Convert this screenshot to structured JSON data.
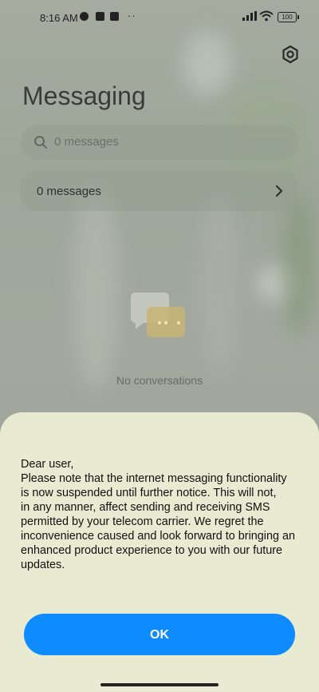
{
  "status_bar": {
    "time": "8:16 AM",
    "more_indicator": "··",
    "battery": "100"
  },
  "header": {
    "title": "Messaging"
  },
  "search": {
    "placeholder": "0 messages"
  },
  "messages_row": {
    "label": "0 messages"
  },
  "empty_state": {
    "text": "No conversations"
  },
  "dialog": {
    "lines": [
      "Dear user,",
      "Please note that the internet messaging functionality",
      "is now suspended until further notice. This will not,",
      "in any manner, affect sending and receiving SMS",
      "permitted by your telecom carrier. We regret the",
      "inconvenience caused and look forward to bringing an",
      "enhanced product experience to you with our future",
      "updates."
    ],
    "ok_label": "OK"
  },
  "colors": {
    "accent": "#0e8bff",
    "sheet_background": "#e8ebd1"
  },
  "icons": {
    "settings": "settings-icon",
    "search": "search-icon",
    "chevron": "chevron-right-icon",
    "empty": "chat-bubbles-icon"
  }
}
